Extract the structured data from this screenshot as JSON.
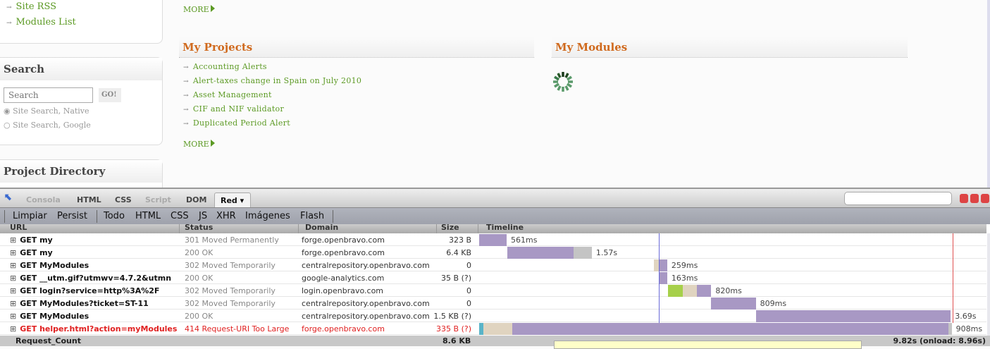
{
  "sidebar": {
    "links": [
      "Site RSS",
      "Modules List"
    ],
    "search": {
      "title": "Search",
      "placeholder": "Search",
      "go": "GO!",
      "options": [
        "Site Search, Native",
        "Site Search, Google"
      ],
      "selected": 0
    },
    "directory_title": "Project Directory"
  },
  "main": {
    "more": "MORE",
    "projects_title": "My Projects",
    "projects": [
      "Accounting Alerts",
      "Alert-taxes change in Spain on July 2010",
      "Asset Management",
      "CIF and NIF validator",
      "Duplicated Period Alert"
    ],
    "modules_title": "My Modules"
  },
  "firebug": {
    "tabs": [
      "Consola",
      "HTML",
      "CSS",
      "Script",
      "DOM"
    ],
    "active_tab": "Red",
    "subtoolbar": [
      "Limpiar",
      "Persist",
      "Todo",
      "HTML",
      "CSS",
      "JS",
      "XHR",
      "Imágenes",
      "Flash"
    ],
    "columns": [
      "URL",
      "Status",
      "Domain",
      "Size",
      "Timeline"
    ],
    "rows": [
      {
        "url": "GET my",
        "status": "301 Moved Permanently",
        "domain": "forge.openbravo.com",
        "size": "323 B",
        "time": "561ms",
        "start": 0,
        "segs": [
          [
            "p",
            0.561
          ]
        ]
      },
      {
        "url": "GET my",
        "status": "200 OK",
        "domain": "forge.openbravo.com",
        "size": "6.4 KB",
        "time": "1.57s",
        "start": 0.58,
        "segs": [
          [
            "p",
            1.35
          ],
          [
            "g",
            0.37
          ]
        ]
      },
      {
        "url": "GET MyModules",
        "status": "302 Moved Temporarily",
        "domain": "centralrepository.openbravo.com",
        "size": "0",
        "time": "259ms",
        "start": 3.57,
        "segs": [
          [
            "t",
            0.1
          ],
          [
            "p",
            0.17
          ]
        ]
      },
      {
        "url": "GET __utm.gif?utmwv=4.7.2&utmn",
        "status": "200 OK",
        "domain": "google-analytics.com",
        "size": "35 B (?)",
        "time": "163ms",
        "start": 3.67,
        "segs": [
          [
            "p",
            0.17
          ]
        ]
      },
      {
        "url": "GET login?service=http%3A%2F",
        "status": "302 Moved Temporarily",
        "domain": "login.openbravo.com",
        "size": "0",
        "time": "820ms",
        "start": 3.86,
        "segs": [
          [
            "l",
            0.3
          ],
          [
            "t",
            0.29
          ],
          [
            "p",
            0.29
          ]
        ]
      },
      {
        "url": "GET MyModules?ticket=ST-11",
        "status": "302 Moved Temporarily",
        "domain": "centralrepository.openbravo.com",
        "size": "0",
        "time": "809ms",
        "start": 4.73,
        "segs": [
          [
            "p",
            0.92
          ]
        ]
      },
      {
        "url": "GET MyModules",
        "status": "200 OK",
        "domain": "centralrepository.openbravo.com",
        "size": "1.5 KB (?)",
        "time": "3.69s",
        "start": 5.66,
        "segs": [
          [
            "p",
            3.97
          ]
        ]
      },
      {
        "url": "GET helper.html?action=myModules",
        "status": "414 Request-URI Too Large",
        "domain": "forge.openbravo.com",
        "size": "335 B (?)",
        "time": "908ms",
        "start": 0,
        "segs": [
          [
            "c",
            0.09
          ],
          [
            "t",
            0.59
          ],
          [
            "p",
            8.9
          ],
          [
            "g",
            0.07
          ]
        ],
        "error": true
      }
    ],
    "dom_loaded_s": 3.67,
    "onload_line_s": 9.67,
    "footer": {
      "label": "Request_Count",
      "size": "8.6 KB",
      "total": "9.82s (onload: 8.96s)"
    }
  },
  "colors": {
    "p": "#a898c4",
    "g": "#c4c4c4",
    "t": "#e0d4c0",
    "l": "#a6d04a",
    "c": "#5ab4c8"
  }
}
